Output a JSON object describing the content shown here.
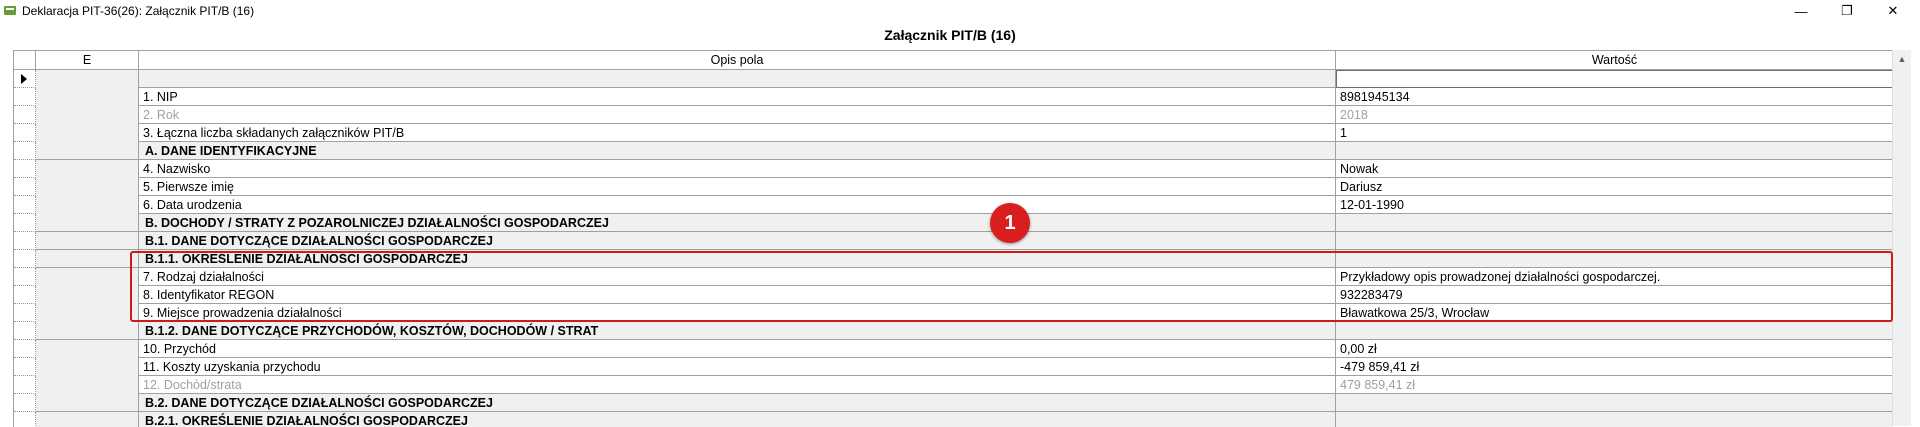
{
  "window": {
    "title": "Deklaracja PIT-36(26): Załącznik PIT/B (16)",
    "buttons": {
      "minimize": "—",
      "maximize": "❐",
      "close": "✕"
    }
  },
  "panel": {
    "title": "Załącznik PIT/B (16)"
  },
  "columns": {
    "e": "E",
    "desc": "Opis pola",
    "value": "Wartość"
  },
  "rows": [
    {
      "desc": "1. NIP",
      "value": "8981945134",
      "dim": false,
      "section": false
    },
    {
      "desc": "2. Rok",
      "value": "2018",
      "dim": true,
      "section": false
    },
    {
      "desc": "3. Łączna liczba składanych załączników PIT/B",
      "value": "1",
      "dim": false,
      "section": false
    },
    {
      "desc": "A. DANE IDENTYFIKACYJNE",
      "value": "",
      "dim": false,
      "section": true
    },
    {
      "desc": "4. Nazwisko",
      "value": "Nowak",
      "dim": false,
      "section": false
    },
    {
      "desc": "5. Pierwsze imię",
      "value": "Dariusz",
      "dim": false,
      "section": false
    },
    {
      "desc": "6. Data urodzenia",
      "value": "12-01-1990",
      "dim": false,
      "section": false
    },
    {
      "desc": "B. DOCHODY / STRATY Z POZAROLNICZEJ DZIAŁALNOŚCI GOSPODARCZEJ",
      "value": "",
      "dim": false,
      "section": true
    },
    {
      "desc": "B.1. DANE DOTYCZĄCE DZIAŁALNOŚCI GOSPODARCZEJ",
      "value": "",
      "dim": false,
      "section": true
    },
    {
      "desc": "B.1.1. OKREŚLENIE DZIAŁALNOŚCI GOSPODARCZEJ",
      "value": "",
      "dim": false,
      "section": true
    },
    {
      "desc": "7. Rodzaj działalności",
      "value": "Przykładowy opis prowadzonej działalności gospodarczej.",
      "dim": false,
      "section": false
    },
    {
      "desc": "8. Identyfikator REGON",
      "value": "932283479",
      "dim": false,
      "section": false
    },
    {
      "desc": "9. Miejsce prowadzenia działalności",
      "value": "Bławatkowa 25/3, Wrocław",
      "dim": false,
      "section": false
    },
    {
      "desc": "B.1.2. DANE DOTYCZĄCE PRZYCHODÓW, KOSZTÓW, DOCHODÓW / STRAT",
      "value": "",
      "dim": false,
      "section": true
    },
    {
      "desc": "10. Przychód",
      "value": "0,00 zł",
      "dim": false,
      "section": false
    },
    {
      "desc": "11. Koszty uzyskania przychodu",
      "value": "-479 859,41 zł",
      "dim": false,
      "section": false
    },
    {
      "desc": "12. Dochód/strata",
      "value": "479 859,41 zł",
      "dim": true,
      "section": false
    },
    {
      "desc": "B.2. DANE DOTYCZĄCE DZIAŁALNOŚCI GOSPODARCZEJ",
      "value": "",
      "dim": false,
      "section": true
    },
    {
      "desc": "B.2.1. OKREŚLENIE DZIAŁALNOŚCI GOSPODARCZEJ",
      "value": "",
      "dim": false,
      "section": true
    }
  ],
  "annotation": {
    "marker_label": "1",
    "marker_color": "#d81e1e"
  },
  "colors": {
    "section_bg": "#f0f0f0",
    "dim_text": "#a0a0a0",
    "highlight": "#d01a1a"
  }
}
